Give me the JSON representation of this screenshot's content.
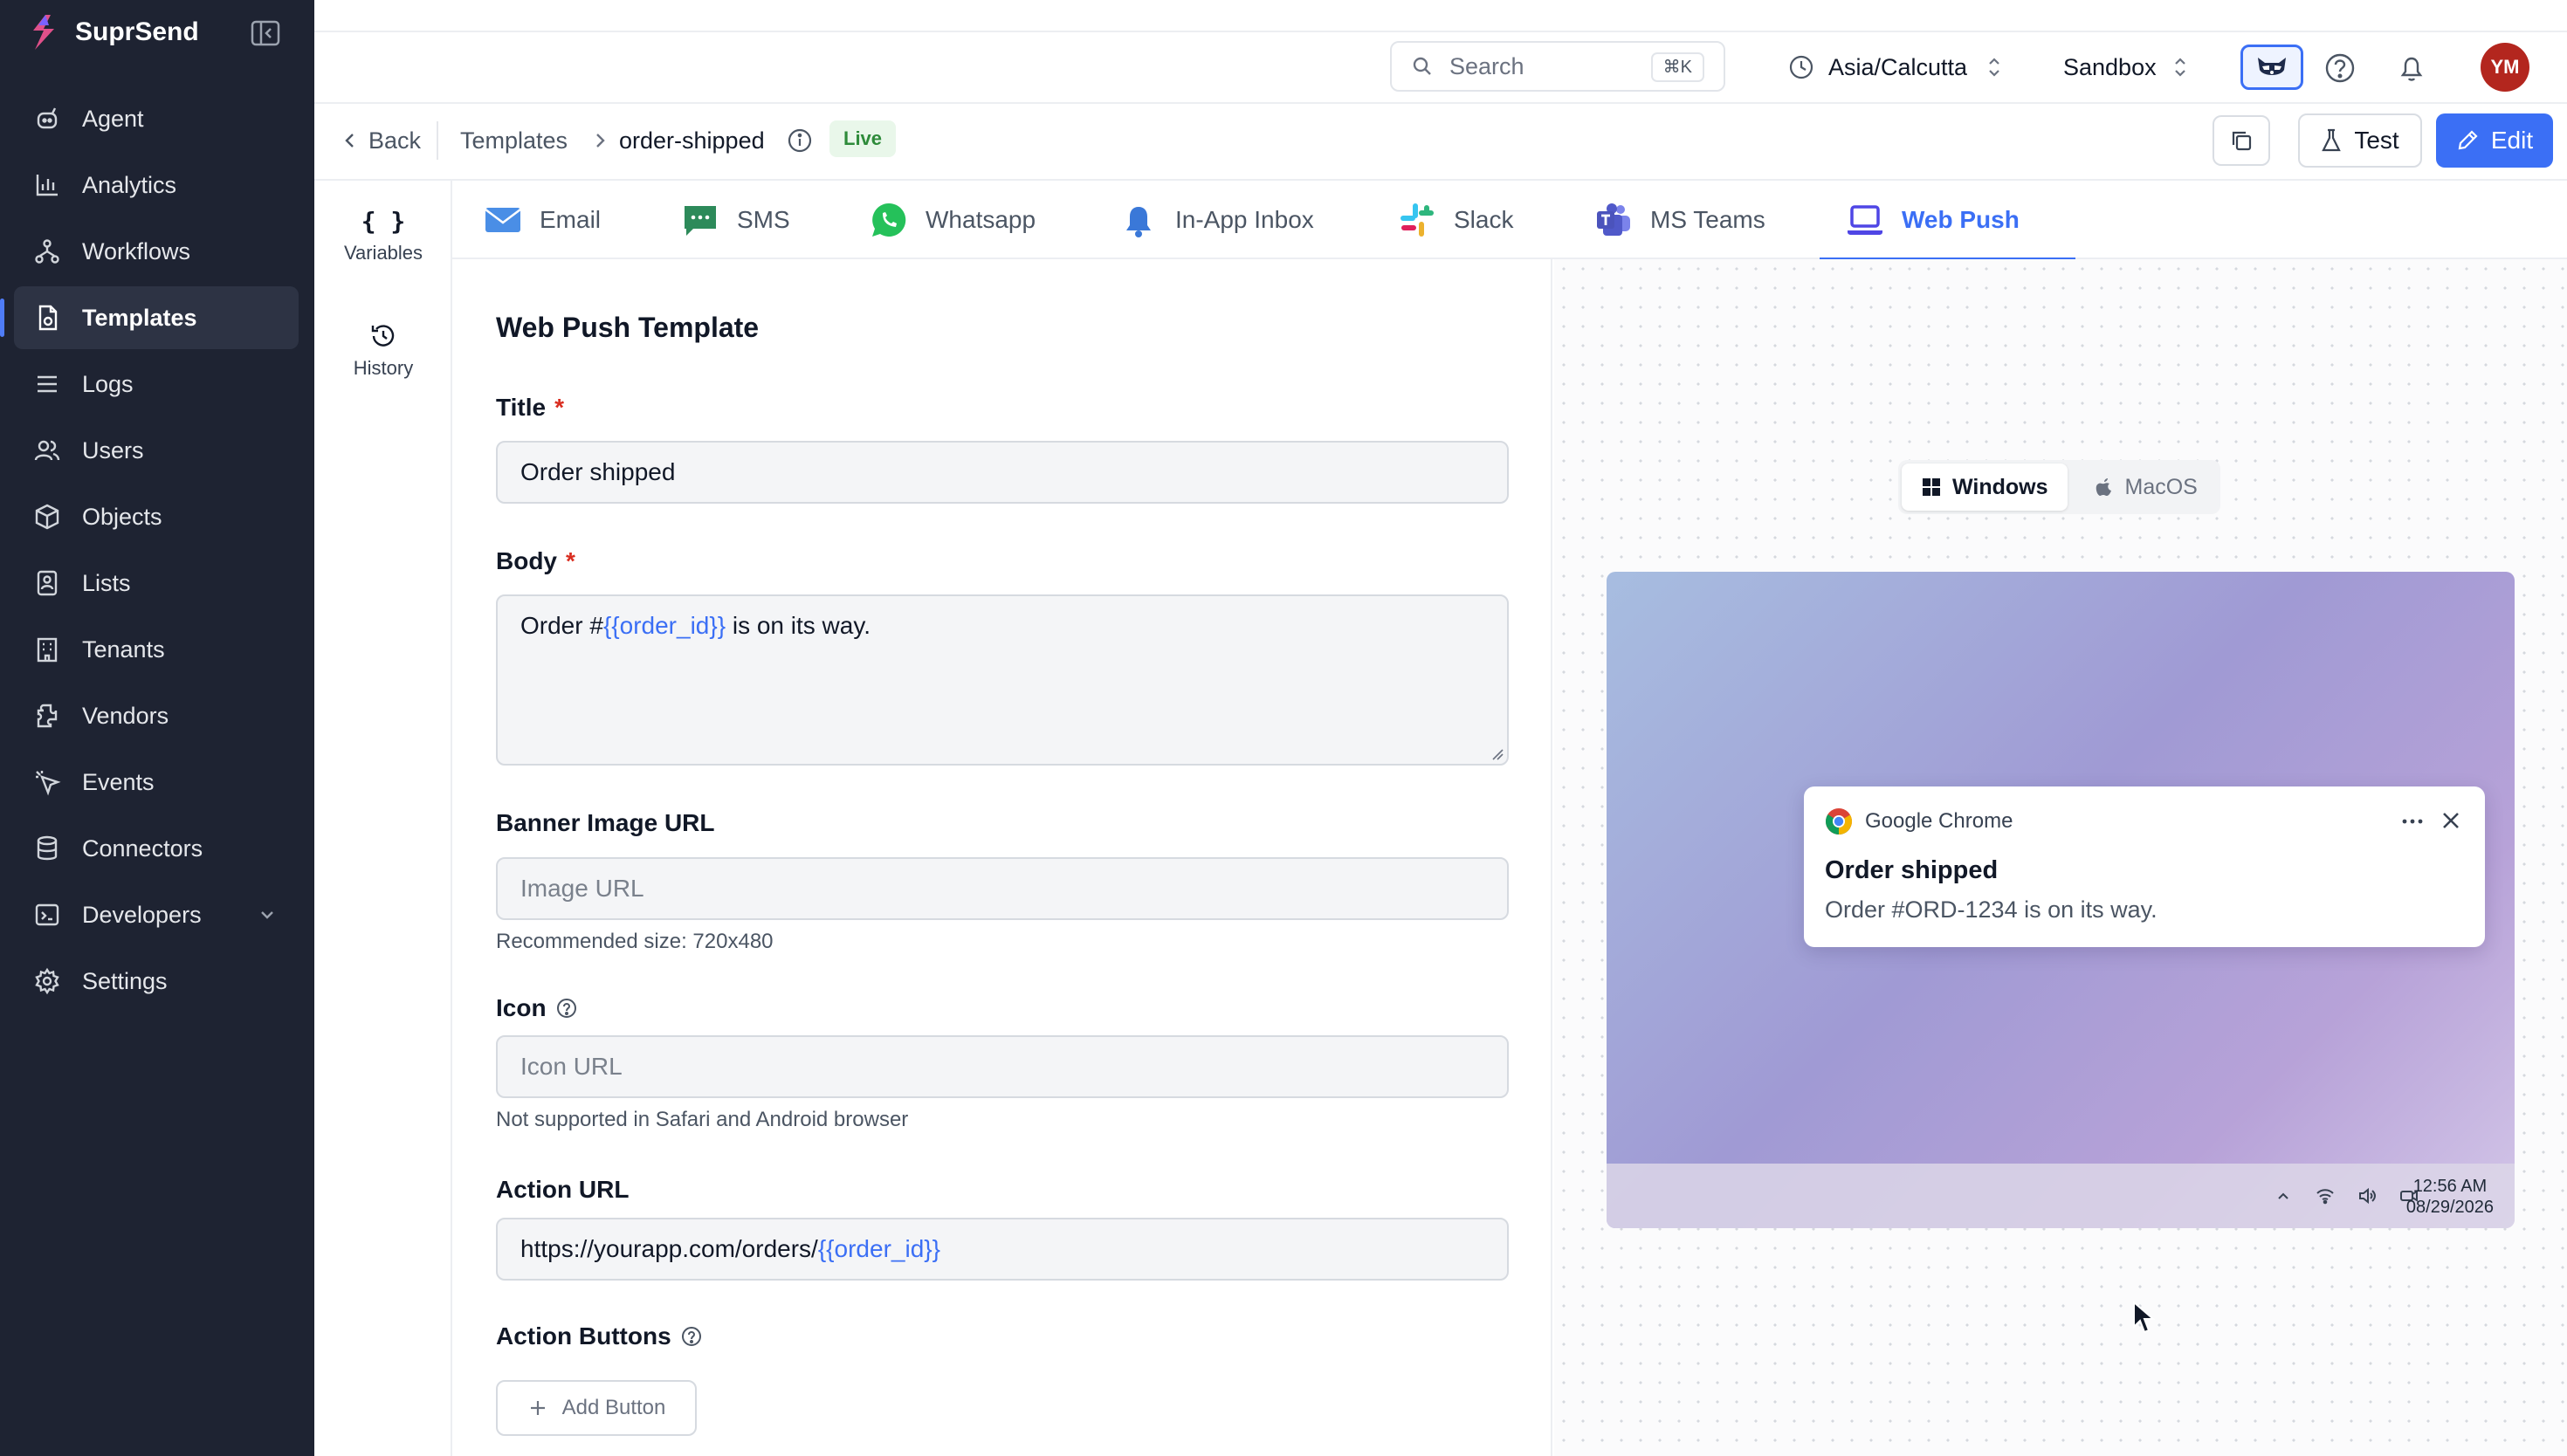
{
  "app": {
    "name": "SuprSend"
  },
  "sidebar": {
    "items": [
      {
        "label": "Agent",
        "icon": "agent-icon"
      },
      {
        "label": "Analytics",
        "icon": "analytics-icon"
      },
      {
        "label": "Workflows",
        "icon": "workflows-icon"
      },
      {
        "label": "Templates",
        "icon": "templates-icon",
        "active": true
      },
      {
        "label": "Logs",
        "icon": "logs-icon"
      },
      {
        "label": "Users",
        "icon": "users-icon"
      },
      {
        "label": "Objects",
        "icon": "objects-icon"
      },
      {
        "label": "Lists",
        "icon": "lists-icon"
      },
      {
        "label": "Tenants",
        "icon": "tenants-icon"
      },
      {
        "label": "Vendors",
        "icon": "vendors-icon"
      },
      {
        "label": "Events",
        "icon": "events-icon"
      },
      {
        "label": "Connectors",
        "icon": "connectors-icon"
      },
      {
        "label": "Developers",
        "icon": "developers-icon",
        "expandable": true
      },
      {
        "label": "Settings",
        "icon": "settings-icon"
      }
    ]
  },
  "topbar": {
    "search_label": "Search",
    "search_shortcut": "⌘K",
    "timezone": "Asia/Calcutta",
    "environment": "Sandbox",
    "avatar_initials": "YM"
  },
  "subheader": {
    "back_label": "Back",
    "breadcrumb_parent": "Templates",
    "breadcrumb_current": "order-shipped",
    "status_badge": "Live",
    "test_label": "Test",
    "edit_label": "Edit"
  },
  "rail": {
    "variables_glyph": "{ }",
    "variables_label": "Variables",
    "history_label": "History"
  },
  "tabs": [
    {
      "label": "Email",
      "icon": "email-icon"
    },
    {
      "label": "SMS",
      "icon": "sms-icon"
    },
    {
      "label": "Whatsapp",
      "icon": "whatsapp-icon"
    },
    {
      "label": "In-App Inbox",
      "icon": "inbox-bell-icon"
    },
    {
      "label": "Slack",
      "icon": "slack-icon"
    },
    {
      "label": "MS Teams",
      "icon": "ms-teams-icon"
    },
    {
      "label": "Web Push",
      "icon": "web-push-icon",
      "active": true
    }
  ],
  "form": {
    "heading": "Web Push Template",
    "title_label": "Title",
    "title_value": "Order shipped",
    "body_label": "Body",
    "body_prefix": "Order #",
    "body_variable": "{{order_id}}",
    "body_suffix": " is on its way.",
    "banner_label": "Banner Image URL",
    "banner_placeholder": "Image URL",
    "banner_hint": "Recommended size: 720x480",
    "icon_label": "Icon",
    "icon_placeholder": "Icon URL",
    "icon_hint": "Not supported in Safari and Android browser",
    "action_url_label": "Action URL",
    "action_url_prefix": "https://yourapp.com/orders/",
    "action_url_variable": "{{order_id}}",
    "action_buttons_label": "Action Buttons",
    "add_button_label": "Add Button"
  },
  "preview": {
    "os_options": [
      "Windows",
      "MacOS"
    ],
    "os_selected": "Windows",
    "notification": {
      "app": "Google Chrome",
      "title": "Order shipped",
      "body": "Order #ORD-1234 is on its way."
    },
    "clock_time": "12:56 AM",
    "clock_date": "08/29/2026"
  },
  "colors": {
    "sidebar_bg": "#1e2332",
    "accent": "#3b6ff5",
    "live_badge_bg": "#e9f7ea",
    "live_badge_text": "#2e8b3a",
    "avatar_bg": "#b3261e",
    "required": "#d92d20"
  }
}
